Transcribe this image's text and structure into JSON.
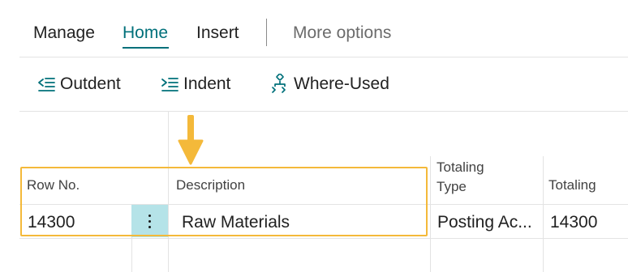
{
  "tabs": {
    "manage": "Manage",
    "home": "Home",
    "insert": "Insert",
    "more": "More options"
  },
  "actions": {
    "outdent": {
      "label": "Outdent",
      "icon": "outdent-icon"
    },
    "indent": {
      "label": "Indent",
      "icon": "indent-icon"
    },
    "where_used": {
      "label": "Where-Used",
      "icon": "where-used-icon"
    }
  },
  "grid": {
    "columns": {
      "row_no": "Row No.",
      "description": "Description",
      "totaling_type": "Totaling Type",
      "totaling_type_line1": "Totaling",
      "totaling_type_line2": "Type",
      "totaling": "Totaling"
    },
    "rows": [
      {
        "row_no": "14300",
        "description": "Raw Materials",
        "totaling_type": "Posting Ac...",
        "totaling": "14300"
      }
    ]
  },
  "colors": {
    "accent": "#00707a",
    "selection": "#b5e3e8",
    "highlight": "#f4b93a",
    "arrow": "#f4b93a"
  }
}
